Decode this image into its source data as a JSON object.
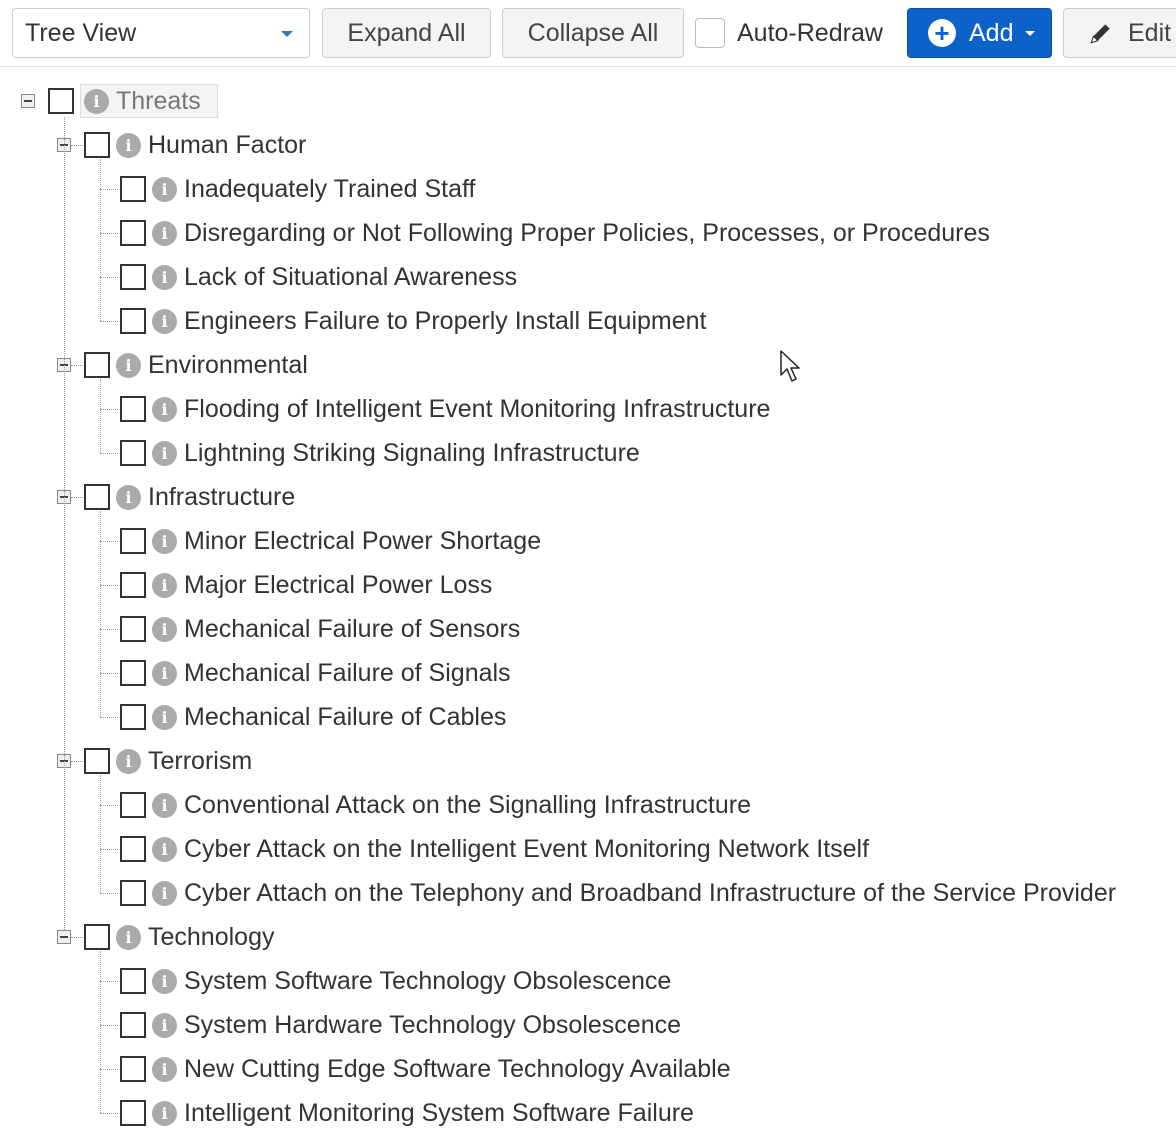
{
  "toolbar": {
    "view_select": "Tree View",
    "expand_label": "Expand All",
    "collapse_label": "Collapse All",
    "auto_redraw_label": "Auto-Redraw",
    "add_label": "Add",
    "edit_label": "Edit"
  },
  "tree": {
    "root": "Threats",
    "groups": [
      {
        "label": "Human Factor",
        "children": [
          "Inadequately Trained Staff",
          "Disregarding or Not Following Proper Policies, Processes, or Procedures",
          "Lack of Situational Awareness",
          "Engineers Failure to Properly Install Equipment"
        ]
      },
      {
        "label": "Environmental",
        "children": [
          "Flooding of Intelligent Event Monitoring Infrastructure",
          "Lightning Striking Signaling Infrastructure"
        ]
      },
      {
        "label": "Infrastructure",
        "children": [
          "Minor Electrical Power Shortage",
          "Major Electrical Power Loss",
          "Mechanical Failure of Sensors",
          "Mechanical Failure of Signals",
          "Mechanical Failure of Cables"
        ]
      },
      {
        "label": "Terrorism",
        "children": [
          "Conventional Attack on the Signalling Infrastructure",
          "Cyber Attack on the Intelligent Event Monitoring Network Itself",
          "Cyber Attach on the Telephony and Broadband Infrastructure of the Service Provider"
        ]
      },
      {
        "label": "Technology",
        "children": [
          "System Software Technology Obsolescence",
          "System Hardware Technology Obsolescence",
          "New Cutting Edge Software Technology Available",
          "Intelligent Monitoring System Software Failure"
        ]
      }
    ]
  },
  "colors": {
    "primary": "#0d62c9",
    "info_icon": "#aaaaaa",
    "text": "#333333"
  }
}
